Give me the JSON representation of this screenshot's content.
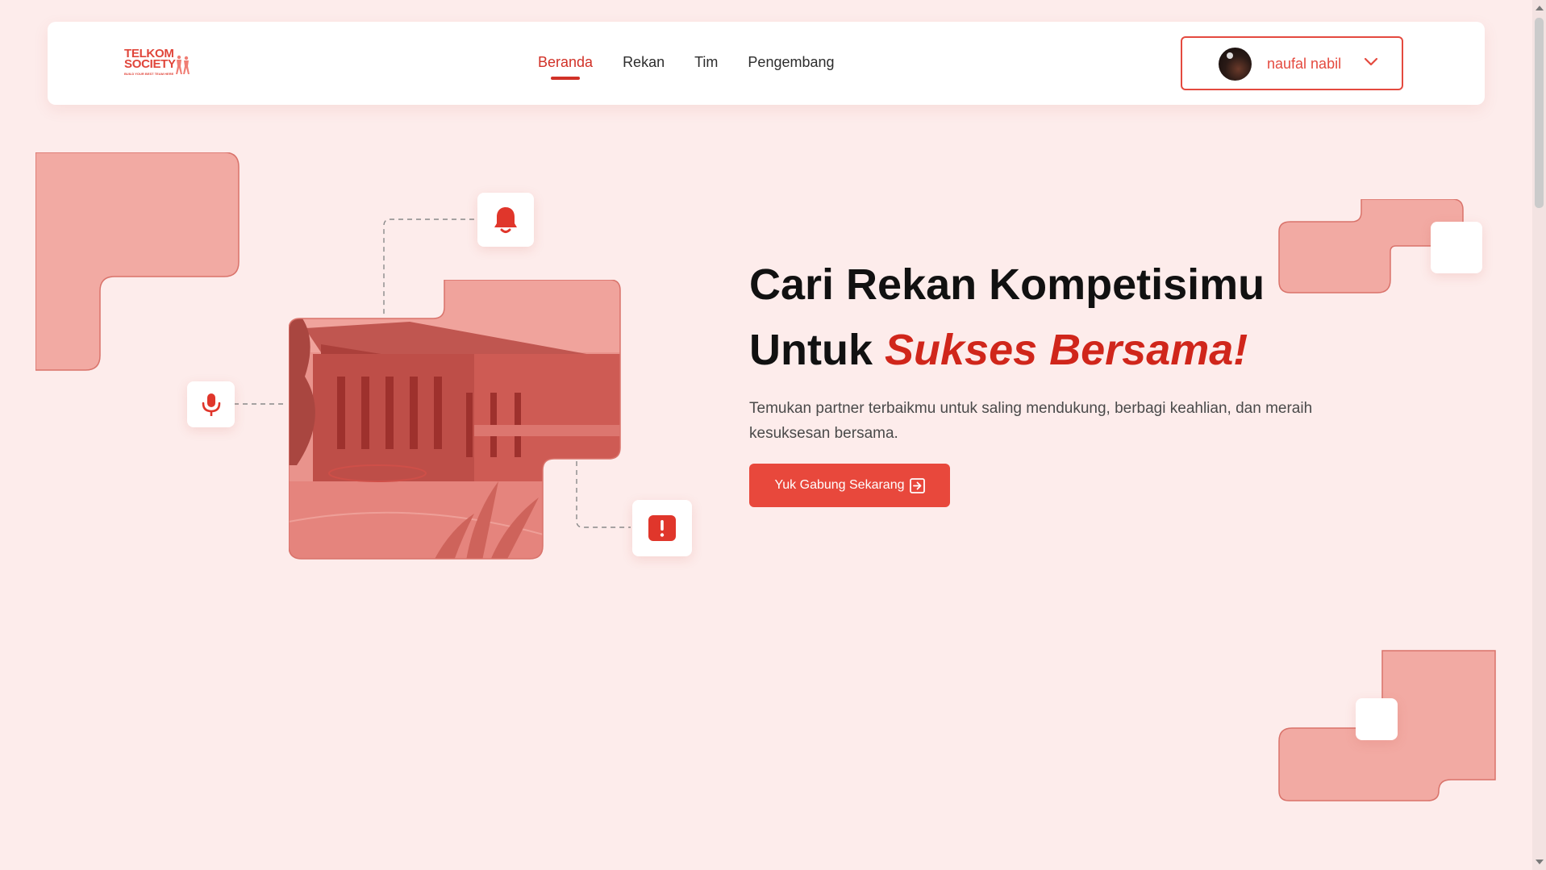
{
  "logo": {
    "line1": "TELKOM",
    "line2": "SOCIETY",
    "tagline": "BUILD YOUR BEST TEAM HERE"
  },
  "nav": {
    "items": [
      {
        "label": "Beranda",
        "active": true
      },
      {
        "label": "Rekan",
        "active": false
      },
      {
        "label": "Tim",
        "active": false
      },
      {
        "label": "Pengembang",
        "active": false
      }
    ]
  },
  "user": {
    "name": "naufal nabil",
    "icon": "chevron-down-icon"
  },
  "hero": {
    "title_line1": "Cari Rekan Kompetisimu",
    "title_line2_plain": "Untuk ",
    "title_line2_accent": "Sukses Bersama!",
    "description": "Temukan partner terbaikmu untuk saling mendukung, berbagi keahlian, dan meraih kesuksesan bersama.",
    "cta_label": "Yuk Gabung Sekarang",
    "cta_icon": "arrow-right-box-icon"
  },
  "icons": {
    "bell": "bell-icon",
    "mic": "microphone-icon",
    "alert": "alert-icon"
  },
  "colors": {
    "brand": "#d13127",
    "button": "#e8483c",
    "background": "#fdeceb",
    "shape": "#f2aaa3"
  }
}
